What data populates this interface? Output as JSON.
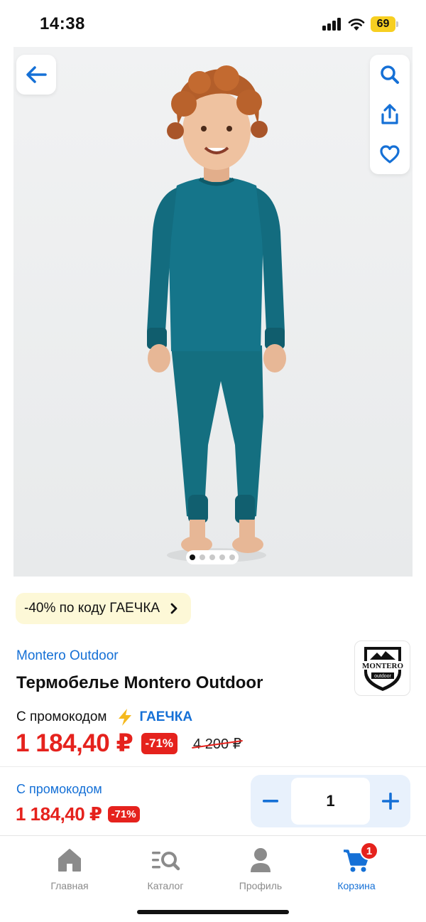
{
  "status_bar": {
    "time": "14:38",
    "battery": "69"
  },
  "gallery": {
    "slide_count": 5,
    "active_slide": 1
  },
  "promo_chip": {
    "text": "-40% по коду ГАЕЧКА"
  },
  "product": {
    "brand": "Montero Outdoor",
    "brand_logo_text": "MONTERO",
    "brand_logo_subtext": "outdoor",
    "title": "Термобелье Montero Outdoor",
    "promo_label": "С промокодом",
    "promo_code": "ГАЕЧКА",
    "price": "1 184,40 ₽",
    "discount": "-71%",
    "old_price": "4 200 ₽"
  },
  "buy_bar": {
    "promo_label": "С промокодом",
    "price": "1 184,40 ₽",
    "discount": "-71%",
    "quantity": "1",
    "minus": "−",
    "plus": "+"
  },
  "tabbar": {
    "items": [
      {
        "label": "Главная",
        "icon": "home-icon"
      },
      {
        "label": "Каталог",
        "icon": "catalog-search-icon"
      },
      {
        "label": "Профиль",
        "icon": "profile-icon"
      },
      {
        "label": "Корзина",
        "icon": "cart-icon",
        "badge": "1",
        "active": true
      }
    ]
  },
  "colors": {
    "accent": "#1570d6",
    "price_red": "#e5221d",
    "promo_bg": "#fdf8d7",
    "garment": "#136e80"
  }
}
